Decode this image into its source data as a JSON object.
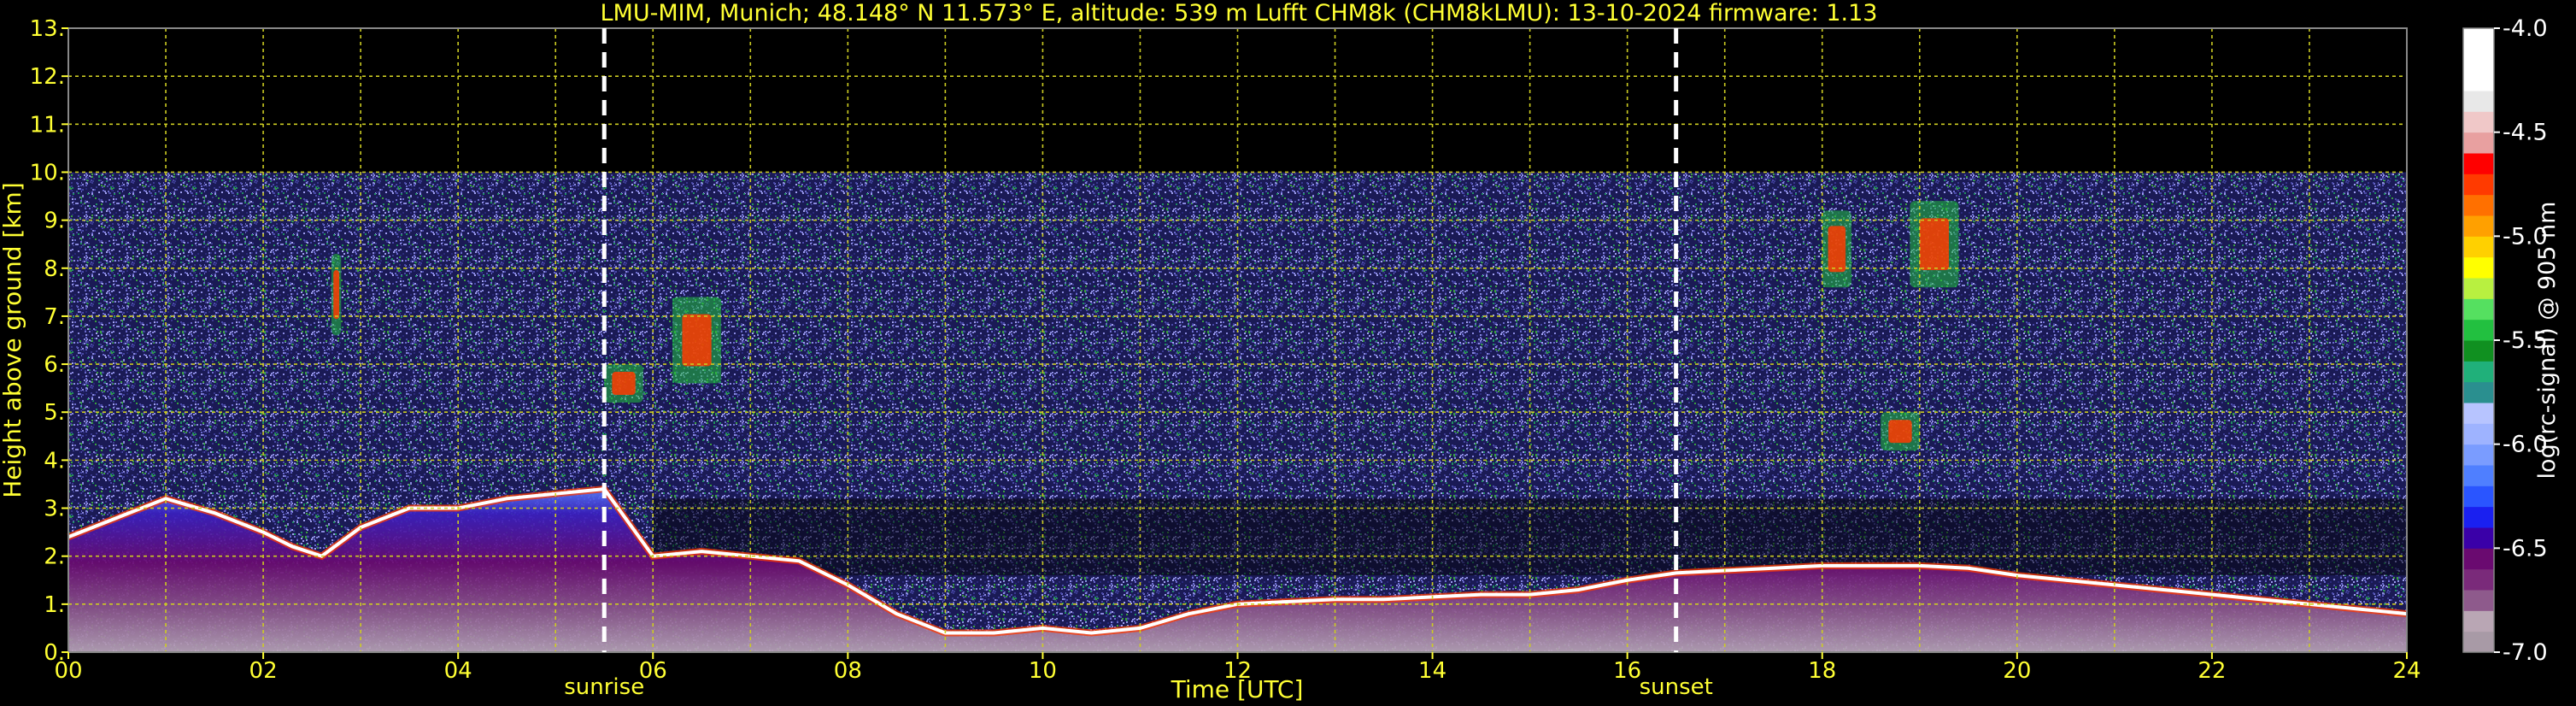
{
  "title": "LMU-MIM, Munich; 48.148° N 11.573° E, altitude: 539 m    Lufft CHM8k (CHM8kLMU): 13-10-2024    firmware: 1.13",
  "colors": {
    "text": "#ffff33",
    "grid": "#cccc22",
    "background": "#000000",
    "marker": "#ffffff"
  },
  "chart_data": {
    "type": "heatmap",
    "xlabel": "Time [UTC]",
    "ylabel": "Height above ground [km]",
    "xlim": [
      0,
      24
    ],
    "ylim": [
      0,
      13
    ],
    "x_ticks": [
      "00",
      "02",
      "04",
      "06",
      "08",
      "10",
      "12",
      "14",
      "16",
      "18",
      "20",
      "22",
      "24"
    ],
    "x_tick_values": [
      0,
      2,
      4,
      6,
      8,
      10,
      12,
      14,
      16,
      18,
      20,
      22,
      24
    ],
    "x_minor_step": 1,
    "y_ticks": [
      "0.",
      "1.",
      "2.",
      "3.",
      "4.",
      "5.",
      "6.",
      "7.",
      "8.",
      "9.",
      "10.",
      "11.",
      "12.",
      "13."
    ],
    "y_tick_values": [
      0,
      1,
      2,
      3,
      4,
      5,
      6,
      7,
      8,
      9,
      10,
      11,
      12,
      13
    ],
    "grid": true,
    "data_top_height_km": 10,
    "markers": [
      {
        "label": "sunrise",
        "time": 5.5
      },
      {
        "label": "sunset",
        "time": 16.5
      }
    ],
    "colorbar": {
      "label": "log(rc-signal) @ 905 nm",
      "range": [
        -7.0,
        -4.0
      ],
      "tick_values": [
        -4.0,
        -4.5,
        -5.0,
        -5.5,
        -6.0,
        -6.5,
        -7.0
      ],
      "ticks": [
        "-4.0",
        "-4.5",
        "-5.0",
        "-5.5",
        "-6.0",
        "-6.5",
        "-7.0"
      ],
      "colors": [
        "#a89aa6",
        "#b9a6b4",
        "#8e5a8c",
        "#7a2a7a",
        "#6a0a70",
        "#3a00a8",
        "#1a20f0",
        "#2a55ff",
        "#4f7fff",
        "#7a9cff",
        "#9eb3ff",
        "#b7c4ff",
        "#2a8f8f",
        "#20b07a",
        "#109020",
        "#22c040",
        "#55e060",
        "#b8f040",
        "#ffff00",
        "#ffd000",
        "#ffa000",
        "#ff7000",
        "#ff3a00",
        "#ff0000",
        "#e8a0a0",
        "#f0c8c8",
        "#e8e8e8",
        "#ffffff",
        "#ffffff",
        "#ffffff"
      ]
    },
    "layers": {
      "boundary_layer_top_km": [
        [
          0.0,
          2.4
        ],
        [
          0.5,
          2.8
        ],
        [
          1.0,
          3.2
        ],
        [
          1.5,
          2.9
        ],
        [
          2.0,
          2.5
        ],
        [
          2.3,
          2.2
        ],
        [
          2.6,
          2.0
        ],
        [
          3.0,
          2.6
        ],
        [
          3.5,
          3.0
        ],
        [
          4.0,
          3.0
        ],
        [
          4.5,
          3.2
        ],
        [
          5.0,
          3.3
        ],
        [
          5.5,
          3.4
        ],
        [
          6.0,
          2.0
        ],
        [
          6.5,
          2.1
        ],
        [
          7.0,
          2.0
        ],
        [
          7.5,
          1.9
        ],
        [
          8.0,
          1.4
        ],
        [
          8.5,
          0.8
        ],
        [
          9.0,
          0.4
        ],
        [
          9.5,
          0.4
        ],
        [
          10.0,
          0.5
        ],
        [
          10.5,
          0.4
        ],
        [
          11.0,
          0.5
        ],
        [
          11.5,
          0.8
        ],
        [
          12.0,
          1.0
        ],
        [
          12.5,
          1.05
        ],
        [
          13.0,
          1.1
        ],
        [
          13.5,
          1.1
        ],
        [
          14.0,
          1.15
        ],
        [
          14.5,
          1.2
        ],
        [
          15.0,
          1.2
        ],
        [
          15.5,
          1.3
        ],
        [
          16.0,
          1.5
        ],
        [
          16.5,
          1.65
        ],
        [
          17.0,
          1.7
        ],
        [
          17.5,
          1.75
        ],
        [
          18.0,
          1.8
        ],
        [
          18.5,
          1.8
        ],
        [
          19.0,
          1.8
        ],
        [
          19.5,
          1.75
        ],
        [
          20.0,
          1.6
        ],
        [
          20.5,
          1.5
        ],
        [
          21.0,
          1.4
        ],
        [
          21.5,
          1.3
        ],
        [
          22.0,
          1.2
        ],
        [
          22.5,
          1.1
        ],
        [
          23.0,
          1.0
        ],
        [
          23.5,
          0.9
        ],
        [
          24.0,
          0.8
        ]
      ],
      "clouds": [
        {
          "t0": 2.7,
          "t1": 2.8,
          "h0": 6.6,
          "h1": 8.3
        },
        {
          "t0": 5.5,
          "t1": 5.9,
          "h0": 5.2,
          "h1": 6.0
        },
        {
          "t0": 6.2,
          "t1": 6.7,
          "h0": 5.6,
          "h1": 7.4
        },
        {
          "t0": 18.0,
          "t1": 18.3,
          "h0": 7.6,
          "h1": 9.2
        },
        {
          "t0": 18.9,
          "t1": 19.4,
          "h0": 7.6,
          "h1": 9.4
        },
        {
          "t0": 18.6,
          "t1": 19.0,
          "h0": 4.2,
          "h1": 5.0
        }
      ]
    }
  }
}
